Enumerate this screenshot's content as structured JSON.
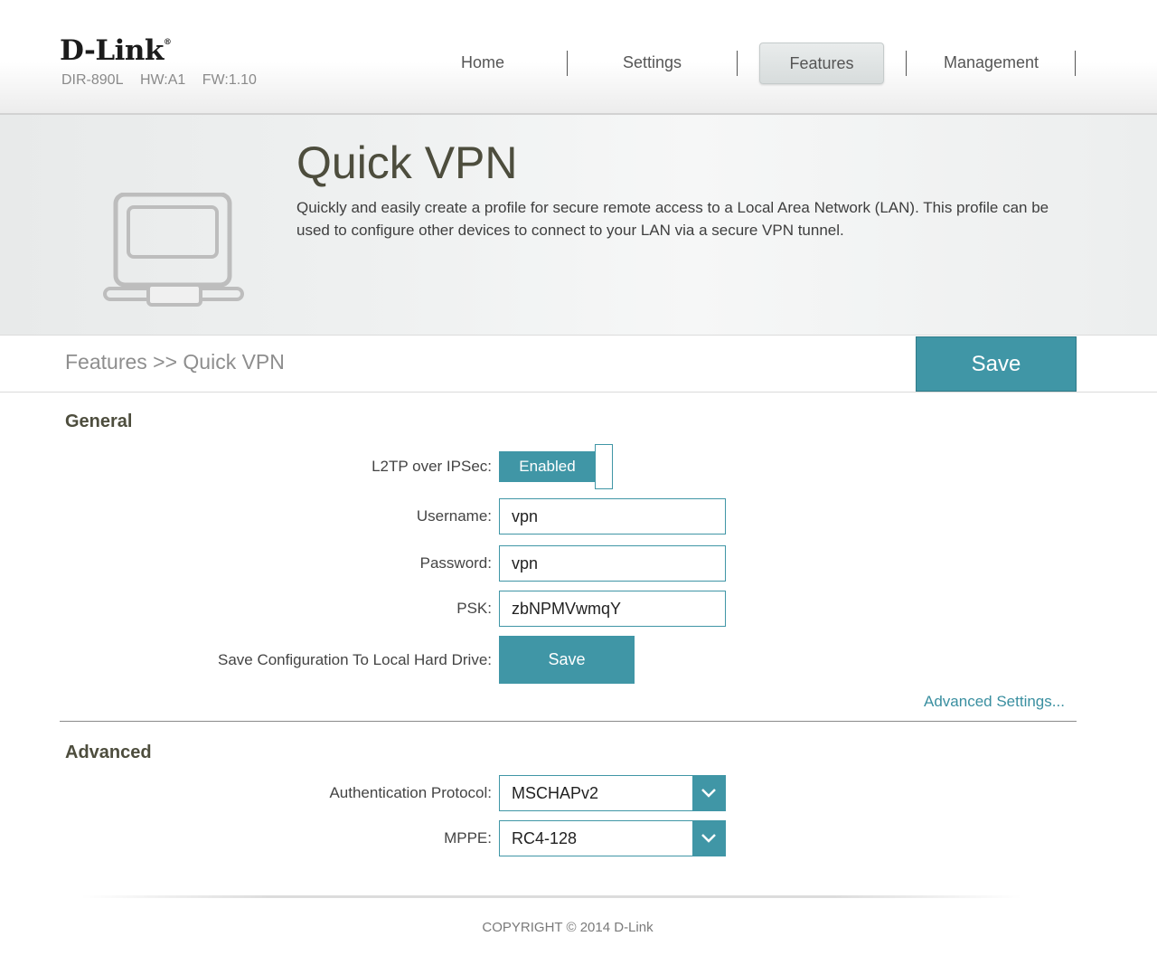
{
  "header": {
    "logo": "D-Link",
    "model": "DIR-890L",
    "hw": "HW:A1",
    "fw": "FW:1.10",
    "nav": [
      {
        "label": "Home"
      },
      {
        "label": "Settings"
      },
      {
        "label": "Features",
        "active": true
      },
      {
        "label": "Management"
      }
    ]
  },
  "banner": {
    "title": "Quick VPN",
    "description": "Quickly and easily create a profile for secure remote access to a Local Area Network (LAN). This profile can be used to configure other devices to connect to your LAN via a secure VPN tunnel.",
    "icon": "computer-network-icon"
  },
  "breadcrumb": "Features >> Quick VPN",
  "save_label": "Save",
  "general": {
    "title": "General",
    "l2tp_label": "L2TP over IPSec:",
    "l2tp_value": "Enabled",
    "username_label": "Username:",
    "username_value": "vpn",
    "password_label": "Password:",
    "password_value": "vpn",
    "psk_label": "PSK:",
    "psk_value": "zbNPMVwmqY",
    "save_config_label": "Save Configuration To Local Hard Drive:",
    "save_config_button": "Save",
    "advanced_link": "Advanced Settings..."
  },
  "advanced": {
    "title": "Advanced",
    "auth_label": "Authentication Protocol:",
    "auth_value": "MSCHAPv2",
    "mppe_label": "MPPE:",
    "mppe_value": "RC4-128"
  },
  "footer": {
    "copyright": "COPYRIGHT © 2014 D-Link"
  },
  "colors": {
    "accent": "#4096a6",
    "title": "#4d4d3d"
  }
}
